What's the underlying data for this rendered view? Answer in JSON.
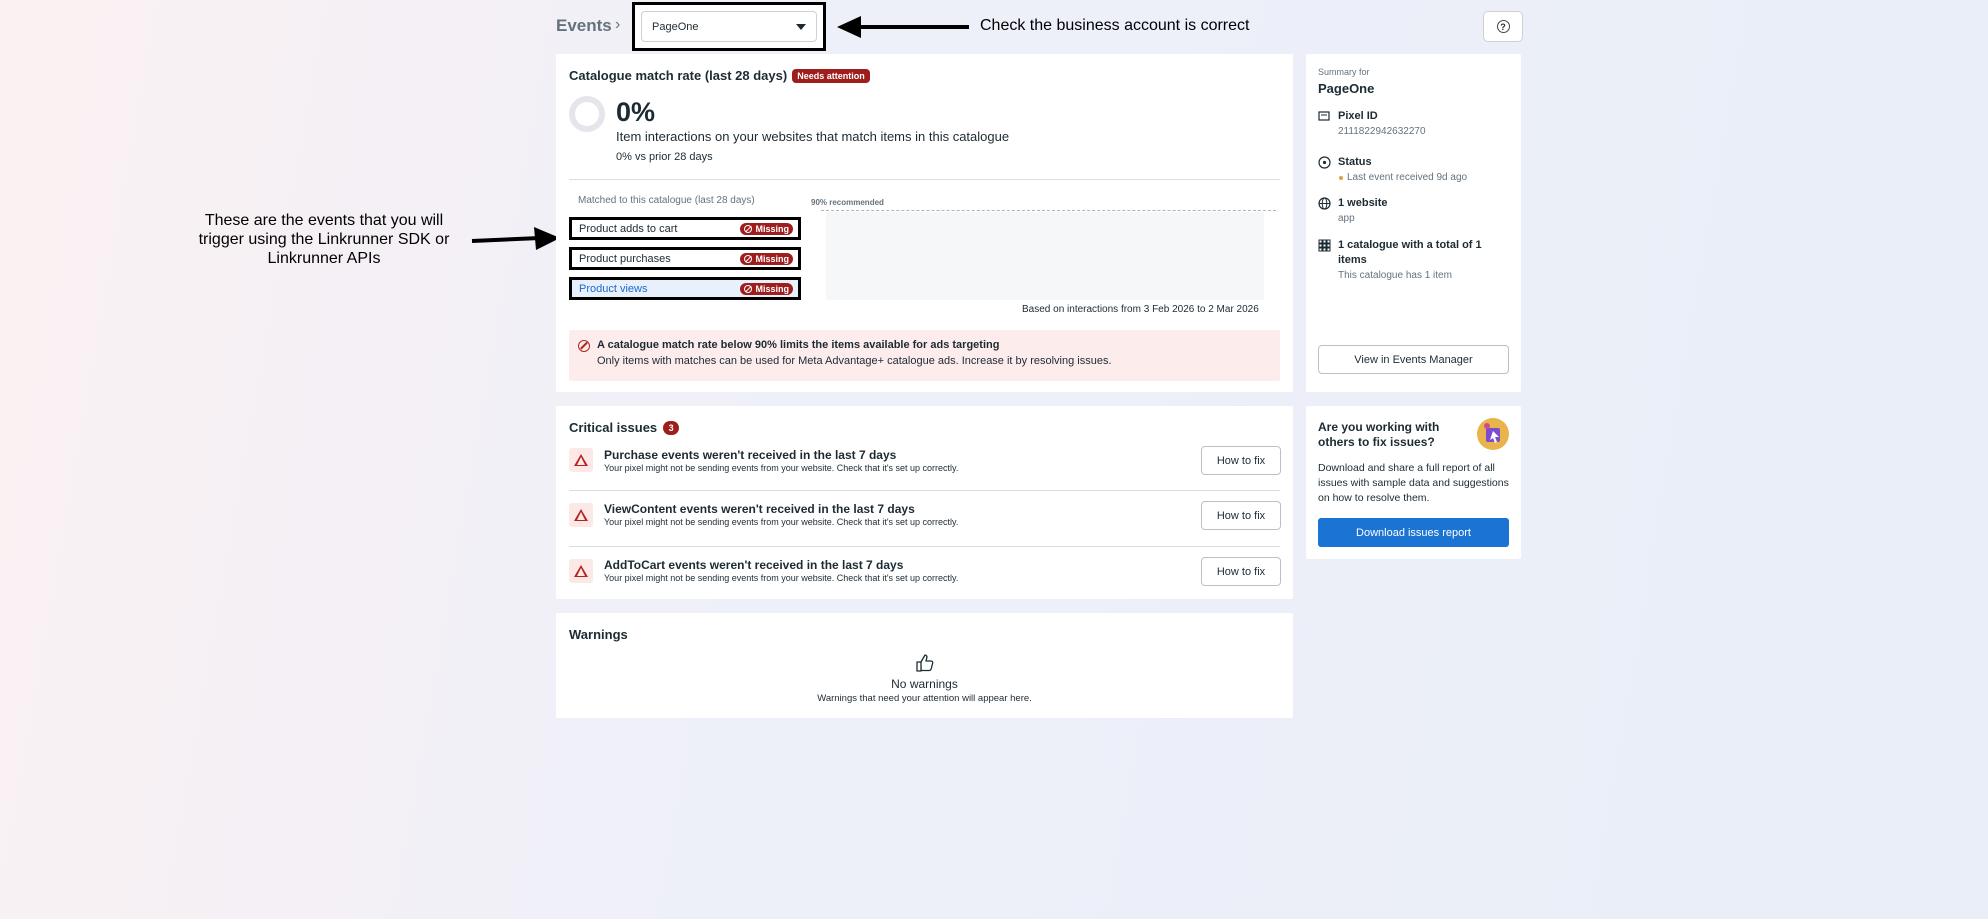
{
  "header": {
    "title": "Events",
    "account": "PageOne",
    "annotation_account": "Check the business account is correct",
    "annotation_events": "These are the events that you will trigger using the Linkrunner SDK or Linkrunner APIs"
  },
  "match": {
    "title": "Catalogue match rate (last 28 days)",
    "badge": "Needs attention",
    "percent": "0%",
    "description": "Item interactions on your websites that match items in this catalogue",
    "comparison": "0% vs prior 28 days",
    "events_heading": "Matched to this catalogue (last 28 days)",
    "recommended_label": "90% recommended",
    "events": [
      {
        "label": "Product adds to cart",
        "status": "Missing"
      },
      {
        "label": "Product purchases",
        "status": "Missing"
      },
      {
        "label": "Product views",
        "status": "Missing"
      }
    ],
    "based_on": "Based on interactions from 3 Feb 2026 to 2 Mar 2026",
    "alert_title": "A catalogue match rate below 90% limits the items available for ads targeting",
    "alert_body": "Only items with matches can be used for Meta Advantage+ catalogue ads. Increase it by resolving issues."
  },
  "summary": {
    "label": "Summary for",
    "name": "PageOne",
    "pixel_label": "Pixel ID",
    "pixel_id": "2111822942632270",
    "status_label": "Status",
    "status_value": "Last event received 9d ago",
    "website_label": "1 website",
    "website_value": "app",
    "catalogue_label": "1 catalogue with a total of 1 items",
    "catalogue_value": "This catalogue has 1 item",
    "button": "View in Events Manager",
    "status_color": "#e2a03f"
  },
  "issues": {
    "title": "Critical issues",
    "count": "3",
    "items": [
      {
        "title": "Purchase events weren't received in the last 7 days",
        "desc": "Your pixel might not be sending events from your website. Check that it's set up correctly.",
        "action": "How to fix"
      },
      {
        "title": "ViewContent events weren't received in the last 7 days",
        "desc": "Your pixel might not be sending events from your website. Check that it's set up correctly.",
        "action": "How to fix"
      },
      {
        "title": "AddToCart events weren't received in the last 7 days",
        "desc": "Your pixel might not be sending events from your website. Check that it's set up correctly.",
        "action": "How to fix"
      }
    ]
  },
  "help": {
    "title": "Are you working with others to fix issues?",
    "body": "Download and share a full report of all issues with sample data and suggestions on how to resolve them.",
    "button": "Download issues report"
  },
  "warnings": {
    "title": "Warnings",
    "empty_title": "No warnings",
    "empty_body": "Warnings that need your attention will appear here."
  }
}
